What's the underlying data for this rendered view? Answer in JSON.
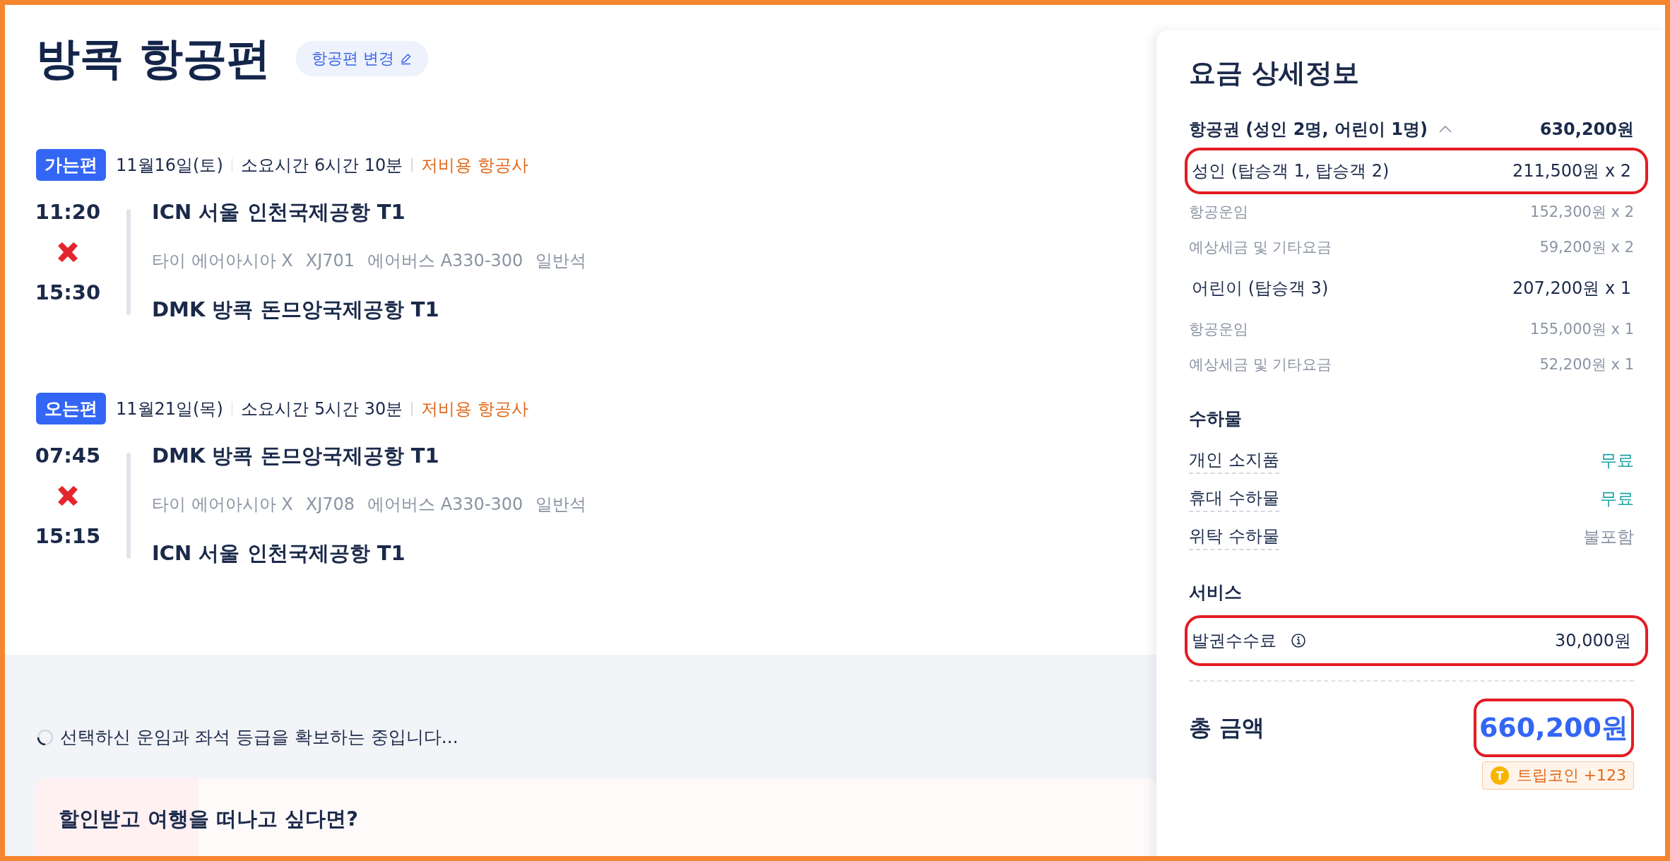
{
  "title": "방콕 항공편",
  "change_button": "항공편 변경",
  "flights": [
    {
      "badge": "가는편",
      "date": "11월16일(토)",
      "duration": "소요시간 6시간 10분",
      "carrier_type": "저비용 항공사",
      "departure_time": "11:20",
      "departure_airport": "ICN 서울 인천국제공항 T1",
      "airline": "타이 에어아시아 X",
      "flight_no": "XJ701",
      "aircraft": "에어버스 A330-300",
      "cabin": "일반석",
      "arrival_time": "15:30",
      "arrival_airport": "DMK 방콕 돈므앙국제공항 T1"
    },
    {
      "badge": "오는편",
      "date": "11월21일(목)",
      "duration": "소요시간 5시간 30분",
      "carrier_type": "저비용 항공사",
      "departure_time": "07:45",
      "departure_airport": "DMK 방콕 돈므앙국제공항 T1",
      "airline": "타이 에어아시아 X",
      "flight_no": "XJ708",
      "aircraft": "에어버스 A330-300",
      "cabin": "일반석",
      "arrival_time": "15:15",
      "arrival_airport": "ICN 서울 인천국제공항 T1"
    }
  ],
  "loading_message": "선택하신 운임과 좌석 등급을 확보하는 중입니다...",
  "promo": {
    "title": "할인받고 여행을 떠나고 싶다면?"
  },
  "fare": {
    "title": "요금 상세정보",
    "ticket": {
      "label": "항공권 (성인 2명, 어린이 1명)",
      "expanded": true,
      "amount": "630,200원"
    },
    "groups": [
      {
        "label": "성인 (탑승객 1, 탑승객 2)",
        "amount": "211,500원 x 2",
        "highlighted": true,
        "items": [
          {
            "label": "항공운임",
            "amount": "152,300원 x 2"
          },
          {
            "label": "예상세금 및 기타요금",
            "amount": "59,200원 x 2"
          }
        ]
      },
      {
        "label": "어린이 (탑승객 3)",
        "amount": "207,200원 x 1",
        "highlighted": false,
        "items": [
          {
            "label": "항공운임",
            "amount": "155,000원 x 1"
          },
          {
            "label": "예상세금 및 기타요금",
            "amount": "52,200원 x 1"
          }
        ]
      }
    ],
    "baggage": {
      "title": "수하물",
      "items": [
        {
          "label": "개인 소지품",
          "value": "무료",
          "included": true
        },
        {
          "label": "휴대 수하물",
          "value": "무료",
          "included": true
        },
        {
          "label": "위탁 수하물",
          "value": "불포함",
          "included": false
        }
      ]
    },
    "services": {
      "title": "서비스",
      "items": [
        {
          "label": "발권수수료",
          "value": "30,000원",
          "info": true,
          "highlighted": true
        }
      ]
    },
    "total": {
      "label": "총 금액",
      "amount": "660,200원",
      "highlighted": true
    },
    "coin": {
      "icon_letter": "T",
      "label": "트립코인 +123"
    }
  }
}
